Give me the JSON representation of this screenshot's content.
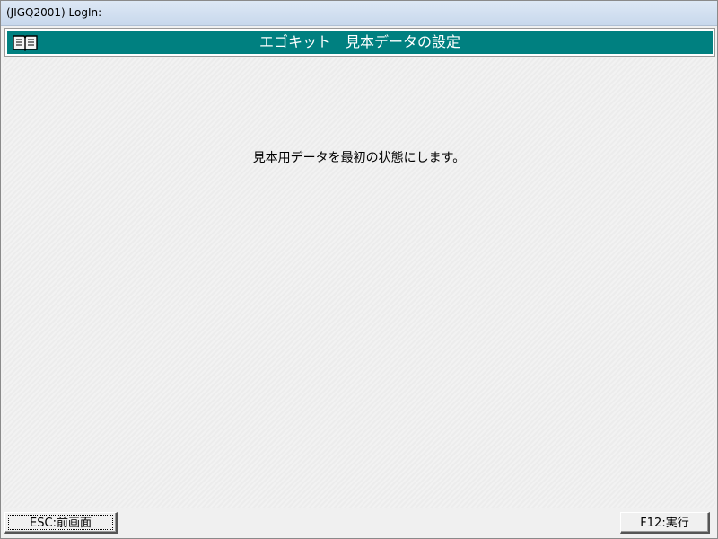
{
  "window": {
    "title": "(JIGQ2001)  LogIn:"
  },
  "header": {
    "icon": "book-icon",
    "title": "エゴキット　見本データの設定",
    "bar_color": "#008080"
  },
  "main": {
    "message": "見本用データを最初の状態にします。"
  },
  "footer": {
    "esc_label": "ESC:前画面",
    "f12_label": "F12:実行"
  }
}
